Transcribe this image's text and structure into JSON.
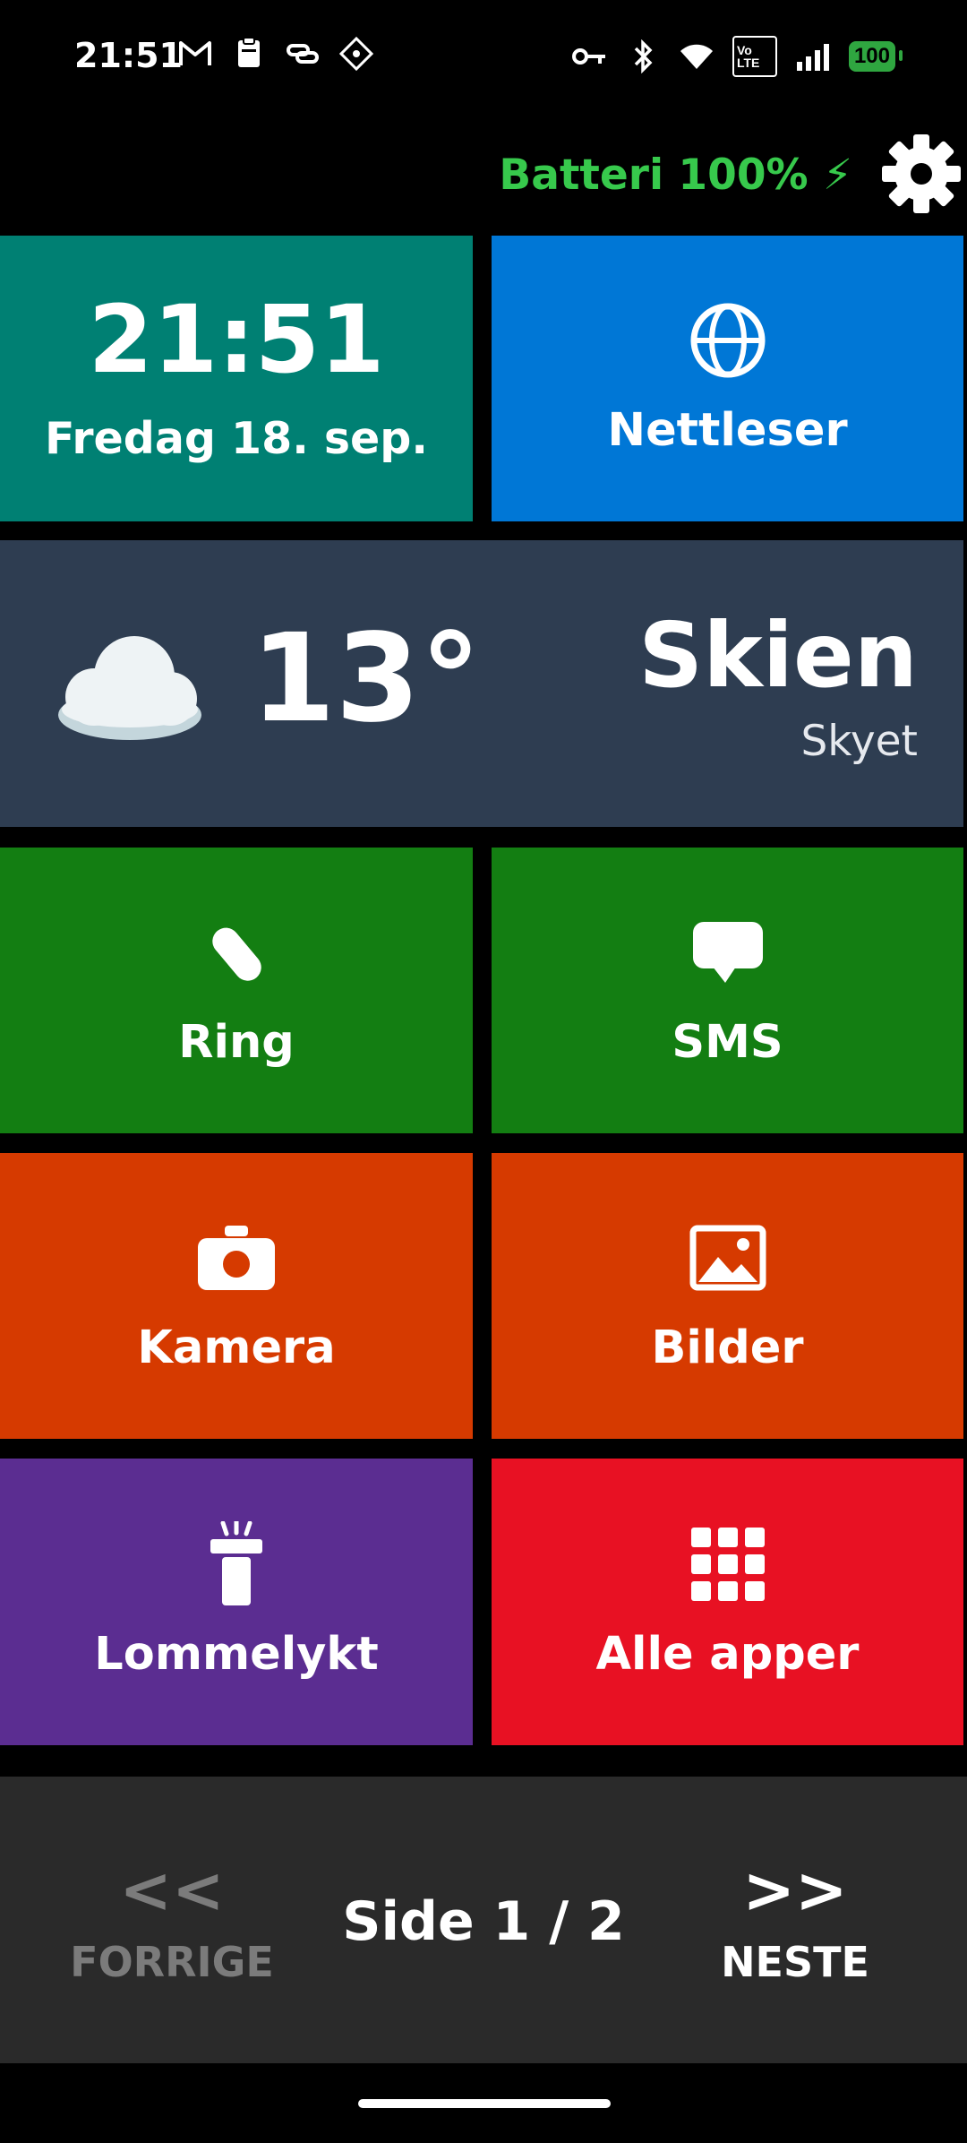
{
  "status_bar": {
    "time": "21:51",
    "left_icons": [
      "gmail-icon",
      "clipboard-icon",
      "link-icon",
      "grid-app-icon"
    ],
    "right_icons": [
      "vpn-key-icon",
      "bluetooth-icon",
      "wifi-icon",
      "volte-icon",
      "signal-icon",
      "battery-icon"
    ],
    "volte_label": "Vo LTE",
    "battery_level": "100"
  },
  "header": {
    "battery_text": "Batteri 100% ⚡",
    "battery_color": "#37c94c",
    "settings_icon": "gear-icon"
  },
  "tiles": {
    "clock": {
      "time": "21:51",
      "date": "Fredag 18. sep.",
      "color": "#008073"
    },
    "browser": {
      "label": "Nettleser",
      "icon": "globe-icon",
      "color": "#0077d6"
    },
    "weather": {
      "temperature": "13°",
      "city": "Skien",
      "condition": "Skyet",
      "icon": "cloud-icon",
      "color": "#2e3d51"
    },
    "call": {
      "label": "Ring",
      "icon": "phone-icon",
      "color": "#137e12"
    },
    "sms": {
      "label": "SMS",
      "icon": "chat-bubble-icon",
      "color": "#137e12"
    },
    "camera": {
      "label": "Kamera",
      "icon": "camera-icon",
      "color": "#d63a00"
    },
    "photos": {
      "label": "Bilder",
      "icon": "image-icon",
      "color": "#d63a00"
    },
    "flashlight": {
      "label": "Lommelykt",
      "icon": "flashlight-icon",
      "color": "#5b2d91"
    },
    "all_apps": {
      "label": "Alle apper",
      "icon": "apps-grid-icon",
      "color": "#e81123"
    }
  },
  "pager": {
    "prev_arrow": "<<",
    "prev_label": "FORRIGE",
    "page_text": "Side 1 / 2",
    "next_arrow": ">>",
    "next_label": "NESTE",
    "disabled_color": "#7b7b7b"
  }
}
